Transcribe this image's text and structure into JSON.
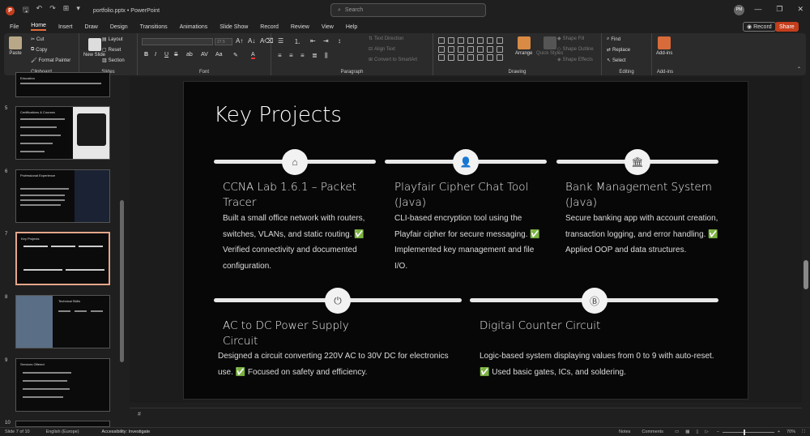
{
  "titlebar": {
    "app_icon": "P",
    "file_name": "portfolio.pptx",
    "separator": "•",
    "app_name": "PowerPoint",
    "search_placeholder": "Search",
    "avatar_initials": "PM",
    "icons": [
      "save-icon",
      "undo-icon",
      "redo-icon",
      "presenter-icon",
      "dropdown-icon",
      "search-icon",
      "minimize-icon",
      "restore-icon",
      "close-icon"
    ]
  },
  "menu": {
    "items": [
      "File",
      "Home",
      "Insert",
      "Draw",
      "Design",
      "Transitions",
      "Animations",
      "Slide Show",
      "Record",
      "Review",
      "View",
      "Help"
    ],
    "active": "Home",
    "record_label": "Record",
    "share_label": "Share"
  },
  "ribbon": {
    "clipboard": {
      "paste": "Paste",
      "cut": "Cut",
      "copy": "Copy",
      "format_painter": "Format Painter",
      "label": "Clipboard"
    },
    "slides": {
      "new_slide": "New Slide",
      "layout": "Layout",
      "reset": "Reset",
      "section": "Section",
      "label": "Slides"
    },
    "font": {
      "size": "27.5",
      "label": "Font",
      "bold": "B",
      "italic": "I",
      "underline": "U",
      "strike": "S"
    },
    "paragraph": {
      "text_direction": "Text Direction",
      "align_text": "Align Text",
      "convert_smartart": "Convert to SmartArt",
      "label": "Paragraph"
    },
    "drawing": {
      "arrange": "Arrange",
      "quick_styles": "Quick Styles",
      "shape_fill": "Shape Fill",
      "shape_outline": "Shape Outline",
      "shape_effects": "Shape Effects",
      "label": "Drawing"
    },
    "editing": {
      "find": "Find",
      "replace": "Replace",
      "select": "Select",
      "label": "Editing"
    },
    "addins": {
      "addins": "Add-ins",
      "label": "Add-ins"
    }
  },
  "thumbnails": [
    {
      "num": "",
      "title": "Education"
    },
    {
      "num": "5",
      "title": "Certifications & Courses"
    },
    {
      "num": "6",
      "title": "Professional Experience"
    },
    {
      "num": "7",
      "title": "Key Projects"
    },
    {
      "num": "8",
      "title": "Technical Skills"
    },
    {
      "num": "9",
      "title": "Services Offered"
    },
    {
      "num": "10",
      "title": ""
    }
  ],
  "slide": {
    "title": "Key Projects",
    "projects": [
      {
        "title": "CCNA Lab 1.6.1 – Packet Tracer",
        "icon": "router-icon",
        "desc": "Built a small office network with routers, switches, VLANs, and static routing. ✅ Verified connectivity and documented configuration."
      },
      {
        "title": "Playfair Cipher Chat Tool (Java)",
        "icon": "user-lock-icon",
        "desc": "CLI-based encryption tool using the Playfair cipher for secure messaging. ✅ Implemented key management and file I/O."
      },
      {
        "title": "Bank Management System (Java)",
        "icon": "bank-icon",
        "desc": "Secure banking app with account creation, transaction logging, and error handling. ✅ Applied OOP and data structures."
      },
      {
        "title": "AC to DC Power Supply Circuit",
        "icon": "power-icon",
        "desc": "Designed a circuit converting 220V AC to 30V DC for electronics use. ✅ Focused on safety and efficiency."
      },
      {
        "title": "Digital Counter Circuit",
        "icon": "bitcoin-icon",
        "desc": "Logic-based system displaying values from 0 to 9 with auto-reset. ✅ Used basic gates, ICs, and soldering."
      }
    ]
  },
  "notes": {
    "text": "#"
  },
  "status": {
    "slide_info": "Slide 7 of 10",
    "language": "English (Europe)",
    "accessibility": "Accessibility: Investigate",
    "notes_btn": "Notes",
    "comments_btn": "Comments",
    "zoom": "70%"
  }
}
